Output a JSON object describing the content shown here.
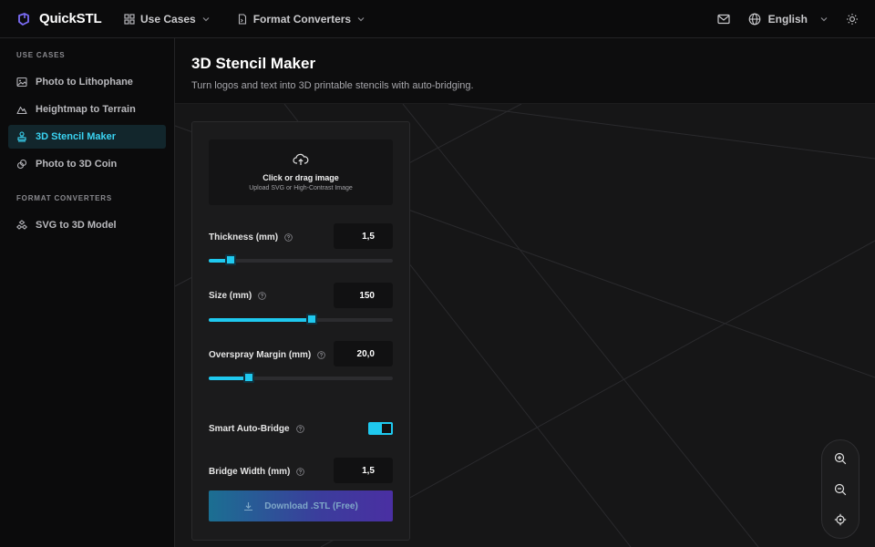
{
  "brand": {
    "name": "QuickSTL"
  },
  "nav": {
    "use_cases": "Use Cases",
    "format_converters": "Format Converters"
  },
  "topright": {
    "language": "English"
  },
  "sidebar": {
    "use_cases_title": "USE CASES",
    "use_cases": [
      {
        "label": "Photo to Lithophane",
        "icon": "image-icon"
      },
      {
        "label": "Heightmap to Terrain",
        "icon": "mountain-icon"
      },
      {
        "label": "3D Stencil Maker",
        "icon": "stamp-icon",
        "active": true
      },
      {
        "label": "Photo to 3D Coin",
        "icon": "coins-icon"
      }
    ],
    "format_title": "FORMAT CONVERTERS",
    "formats": [
      {
        "label": "SVG to 3D Model",
        "icon": "shapes-icon"
      }
    ]
  },
  "page": {
    "title": "3D Stencil Maker",
    "subtitle": "Turn logos and text into 3D printable stencils with auto-bridging."
  },
  "upload": {
    "title": "Click or drag image",
    "subtitle": "Upload SVG or High-Contrast Image"
  },
  "controls": {
    "thickness": {
      "label": "Thickness (mm)",
      "value": "1,5",
      "fraction": 0.12
    },
    "size": {
      "label": "Size (mm)",
      "value": "150",
      "fraction": 0.56
    },
    "overspray": {
      "label": "Overspray Margin (mm)",
      "value": "20,0",
      "fraction": 0.22
    },
    "auto_bridge": {
      "label": "Smart Auto-Bridge",
      "on": true
    },
    "bridge_width": {
      "label": "Bridge Width (mm)",
      "value": "1,5"
    }
  },
  "download": {
    "label": "Download .STL (Free)"
  },
  "colors": {
    "accent": "#1fc9ef",
    "active_bg": "#12262c",
    "background": "#0c0c0d"
  }
}
